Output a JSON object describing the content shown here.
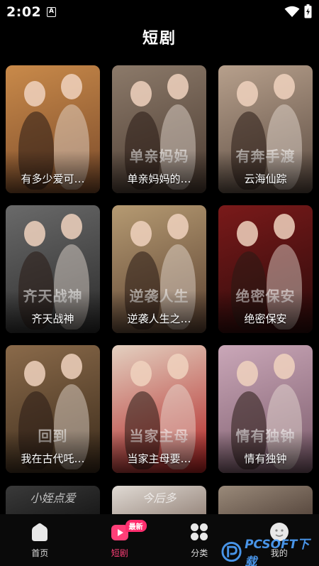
{
  "status": {
    "time": "2:02",
    "notification_letter": "A"
  },
  "header": {
    "title": "短剧"
  },
  "dramas": [
    {
      "title": "有多少爱可…",
      "palette": [
        "#c98a4a",
        "#7a4a2a"
      ]
    },
    {
      "title": "单亲妈妈的…",
      "palette": [
        "#8c7a6a",
        "#4a3a30"
      ],
      "poster_text": "单亲妈妈"
    },
    {
      "title": "云海仙踪",
      "palette": [
        "#b7a08c",
        "#5a4a40"
      ],
      "poster_text": "有奔手渡"
    },
    {
      "title": "齐天战神",
      "palette": [
        "#6a6a6a",
        "#2a2a2a"
      ],
      "poster_text": "齐天战神"
    },
    {
      "title": "逆袭人生之…",
      "palette": [
        "#b59a72",
        "#5a4030"
      ],
      "poster_text": "逆袭人生"
    },
    {
      "title": "绝密保安",
      "palette": [
        "#7a1a1a",
        "#2a0a0a"
      ],
      "poster_text": "绝密保安"
    },
    {
      "title": "我在古代吒…",
      "palette": [
        "#8a6a4a",
        "#3a2a1a"
      ],
      "poster_text": "回到"
    },
    {
      "title": "当家主母要…",
      "palette": [
        "#e3d0c0",
        "#b02020"
      ],
      "poster_text": "当家主母"
    },
    {
      "title": "情有独钟",
      "palette": [
        "#caa7b8",
        "#7a5a6a"
      ],
      "poster_text": "情有独钟"
    }
  ],
  "partial_posters": [
    {
      "text": "小姪点爱",
      "palette": [
        "#3a3a3a",
        "#1a1a1a"
      ]
    },
    {
      "text": "今后多",
      "palette": [
        "#e0dad4",
        "#9a8a80"
      ]
    },
    {
      "text": "",
      "palette": [
        "#9a8a7a",
        "#5a4a40"
      ]
    }
  ],
  "nav": {
    "items": [
      {
        "label": "首页",
        "icon": "home-icon"
      },
      {
        "label": "短剧",
        "icon": "drama-play-icon",
        "badge": "最新"
      },
      {
        "label": "分类",
        "icon": "category-grid-icon"
      },
      {
        "label": "我的",
        "icon": "profile-icon"
      }
    ],
    "active_index": 1,
    "active_color": "#ff3f78"
  },
  "watermark": {
    "text": "PCSOFT下载"
  }
}
